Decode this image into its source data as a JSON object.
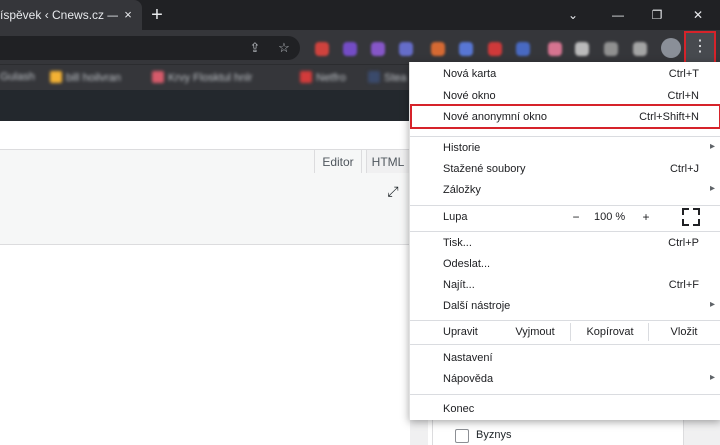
{
  "browser": {
    "tab_title": "íspěvek ‹ Cnews.cz — W",
    "tab_close_icon": "×",
    "new_tab_icon": "+",
    "window_controls": {
      "tabsearch": "⌄",
      "minimize": "—",
      "restore": "❐",
      "close": "✕"
    },
    "omnibox_icons": {
      "share": "⇪",
      "star": "☆"
    },
    "menu_icon": "⋮",
    "bookmarks": [
      "Gulash",
      "bill hoilvran",
      "Krvy Flosktul hnlr",
      "Netfro",
      "Stea"
    ]
  },
  "page": {
    "tabs": {
      "editor": "Editor",
      "html": "HTML"
    },
    "fullscreen_icon": "⤢",
    "checkbox_label": "Byznys"
  },
  "menu": {
    "items_top": [
      {
        "label": "Nová karta",
        "shortcut": "Ctrl+T"
      },
      {
        "label": "Nové okno",
        "shortcut": "Ctrl+N"
      },
      {
        "label": "Nové anonymní okno",
        "shortcut": "Ctrl+Shift+N"
      }
    ],
    "items_history": [
      {
        "label": "Historie",
        "shortcut": "",
        "arrow": "▸"
      },
      {
        "label": "Stažené soubory",
        "shortcut": "Ctrl+J",
        "arrow": ""
      },
      {
        "label": "Záložky",
        "shortcut": "",
        "arrow": "▸"
      }
    ],
    "zoom": {
      "label": "Lupa",
      "minus": "−",
      "value": "100 %",
      "plus": "+"
    },
    "items_tools": [
      {
        "label": "Tisk...",
        "shortcut": "Ctrl+P",
        "arrow": ""
      },
      {
        "label": "Odeslat...",
        "shortcut": "",
        "arrow": ""
      },
      {
        "label": "Najít...",
        "shortcut": "Ctrl+F",
        "arrow": ""
      },
      {
        "label": "Další nástroje",
        "shortcut": "",
        "arrow": "▸"
      }
    ],
    "edit": {
      "label": "Upravit",
      "cut": "Vyjmout",
      "copy": "Kopírovat",
      "paste": "Vložit"
    },
    "items_settings": [
      {
        "label": "Nastavení",
        "shortcut": "",
        "arrow": ""
      },
      {
        "label": "Nápověda",
        "shortcut": "",
        "arrow": "▸"
      }
    ],
    "exit": "Konec"
  },
  "colors": {
    "highlight": "#d6232a",
    "tabbar": "#202124",
    "toolbar": "#35363a",
    "admin_bar": "#23282d"
  }
}
